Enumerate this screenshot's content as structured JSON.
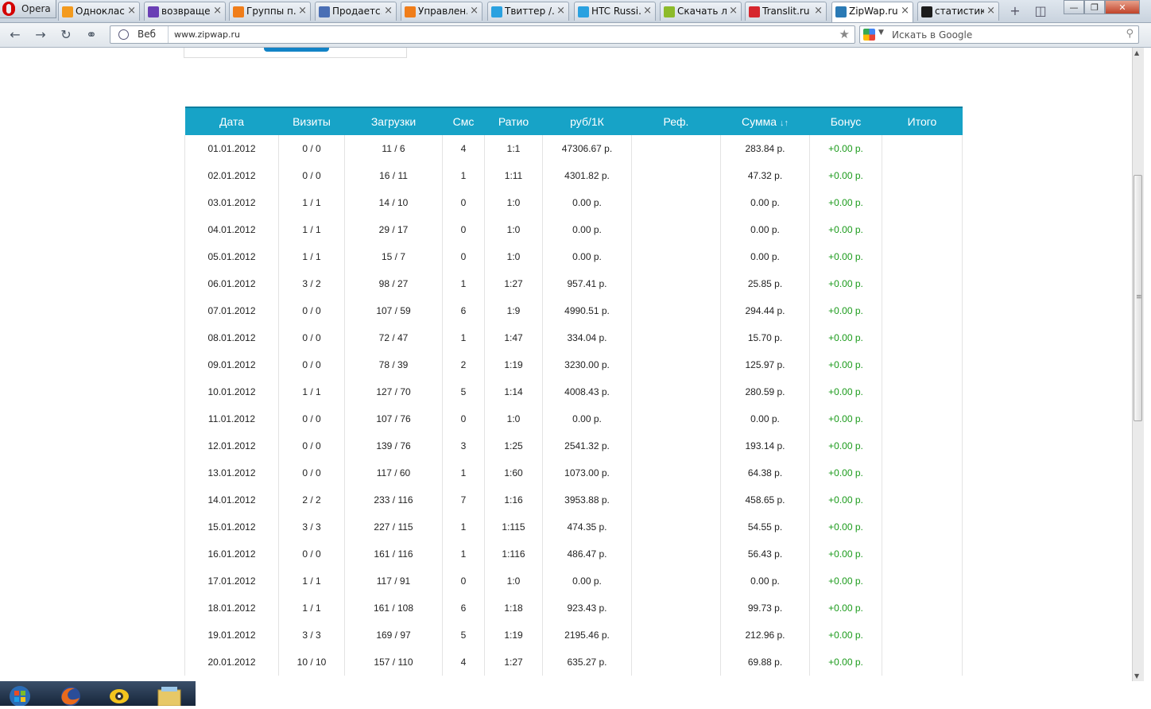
{
  "browser": {
    "menu_label": "Opera",
    "tabs": [
      {
        "title": "Одноклас...",
        "color": "#f39a1e"
      },
      {
        "title": "возвраще...",
        "color": "#6a3fb5"
      },
      {
        "title": "Группы п...",
        "color": "#f07d1a"
      },
      {
        "title": "Продаетс...",
        "color": "#4a6fb5"
      },
      {
        "title": "Управлен...",
        "color": "#f07d1a"
      },
      {
        "title": "Твиттер /...",
        "color": "#2aa1e0"
      },
      {
        "title": "HTC Russi...",
        "color": "#2aa1e0"
      },
      {
        "title": "Скачать л...",
        "color": "#8dbb2a"
      },
      {
        "title": "Translit.ru ...",
        "color": "#d6262e"
      },
      {
        "title": "ZipWap.ru",
        "color": "#2a7ab5"
      },
      {
        "title": "статистик...",
        "color": "#1c1c1c"
      }
    ],
    "active_tab": 9,
    "address_label": "Веб",
    "url": "www.zipwap.ru",
    "search_placeholder": "Искать в Google"
  },
  "stats_table": {
    "columns": [
      "Дата",
      "Визиты",
      "Загрузки",
      "Смс",
      "Ратио",
      "руб/1К",
      "Реф.",
      "Сумма",
      "Бонус",
      "Итого"
    ],
    "sort_arrows": "↓↑",
    "rows": [
      [
        "01.01.2012",
        "0 / 0",
        "11 / 6",
        "4",
        "1:1",
        "47306.67 р.",
        "",
        "283.84 р.",
        "+0.00 р.",
        ""
      ],
      [
        "02.01.2012",
        "0 / 0",
        "16 / 11",
        "1",
        "1:11",
        "4301.82 р.",
        "",
        "47.32 р.",
        "+0.00 р.",
        ""
      ],
      [
        "03.01.2012",
        "1 / 1",
        "14 / 10",
        "0",
        "1:0",
        "0.00 р.",
        "",
        "0.00 р.",
        "+0.00 р.",
        ""
      ],
      [
        "04.01.2012",
        "1 / 1",
        "29 / 17",
        "0",
        "1:0",
        "0.00 р.",
        "",
        "0.00 р.",
        "+0.00 р.",
        ""
      ],
      [
        "05.01.2012",
        "1 / 1",
        "15 / 7",
        "0",
        "1:0",
        "0.00 р.",
        "",
        "0.00 р.",
        "+0.00 р.",
        ""
      ],
      [
        "06.01.2012",
        "3 / 2",
        "98 / 27",
        "1",
        "1:27",
        "957.41 р.",
        "",
        "25.85 р.",
        "+0.00 р.",
        ""
      ],
      [
        "07.01.2012",
        "0 / 0",
        "107 / 59",
        "6",
        "1:9",
        "4990.51 р.",
        "",
        "294.44 р.",
        "+0.00 р.",
        ""
      ],
      [
        "08.01.2012",
        "0 / 0",
        "72 / 47",
        "1",
        "1:47",
        "334.04 р.",
        "",
        "15.70 р.",
        "+0.00 р.",
        ""
      ],
      [
        "09.01.2012",
        "0 / 0",
        "78 / 39",
        "2",
        "1:19",
        "3230.00 р.",
        "",
        "125.97 р.",
        "+0.00 р.",
        ""
      ],
      [
        "10.01.2012",
        "1 / 1",
        "127 / 70",
        "5",
        "1:14",
        "4008.43 р.",
        "",
        "280.59 р.",
        "+0.00 р.",
        ""
      ],
      [
        "11.01.2012",
        "0 / 0",
        "107 / 76",
        "0",
        "1:0",
        "0.00 р.",
        "",
        "0.00 р.",
        "+0.00 р.",
        ""
      ],
      [
        "12.01.2012",
        "0 / 0",
        "139 / 76",
        "3",
        "1:25",
        "2541.32 р.",
        "",
        "193.14 р.",
        "+0.00 р.",
        ""
      ],
      [
        "13.01.2012",
        "0 / 0",
        "117 / 60",
        "1",
        "1:60",
        "1073.00 р.",
        "",
        "64.38 р.",
        "+0.00 р.",
        ""
      ],
      [
        "14.01.2012",
        "2 / 2",
        "233 / 116",
        "7",
        "1:16",
        "3953.88 р.",
        "",
        "458.65 р.",
        "+0.00 р.",
        ""
      ],
      [
        "15.01.2012",
        "3 / 3",
        "227 / 115",
        "1",
        "1:115",
        "474.35 р.",
        "",
        "54.55 р.",
        "+0.00 р.",
        ""
      ],
      [
        "16.01.2012",
        "0 / 0",
        "161 / 116",
        "1",
        "1:116",
        "486.47 р.",
        "",
        "56.43 р.",
        "+0.00 р.",
        ""
      ],
      [
        "17.01.2012",
        "1 / 1",
        "117 / 91",
        "0",
        "1:0",
        "0.00 р.",
        "",
        "0.00 р.",
        "+0.00 р.",
        ""
      ],
      [
        "18.01.2012",
        "1 / 1",
        "161 / 108",
        "6",
        "1:18",
        "923.43 р.",
        "",
        "99.73 р.",
        "+0.00 р.",
        ""
      ],
      [
        "19.01.2012",
        "3 / 3",
        "169 / 97",
        "5",
        "1:19",
        "2195.46 р.",
        "",
        "212.96 р.",
        "+0.00 р.",
        ""
      ],
      [
        "20.01.2012",
        "10 / 10",
        "157 / 110",
        "4",
        "1:27",
        "635.27 р.",
        "",
        "69.88 р.",
        "+0.00 р.",
        ""
      ]
    ]
  },
  "colors": {
    "header_bg": "#17a3c7",
    "bonus_text": "#1a9a1a",
    "button_blue": "#1283c6"
  },
  "taskbar": {
    "icons": [
      "windows-start-icon",
      "firefox-icon",
      "qip-icon",
      "explorer-folder-icon"
    ]
  }
}
